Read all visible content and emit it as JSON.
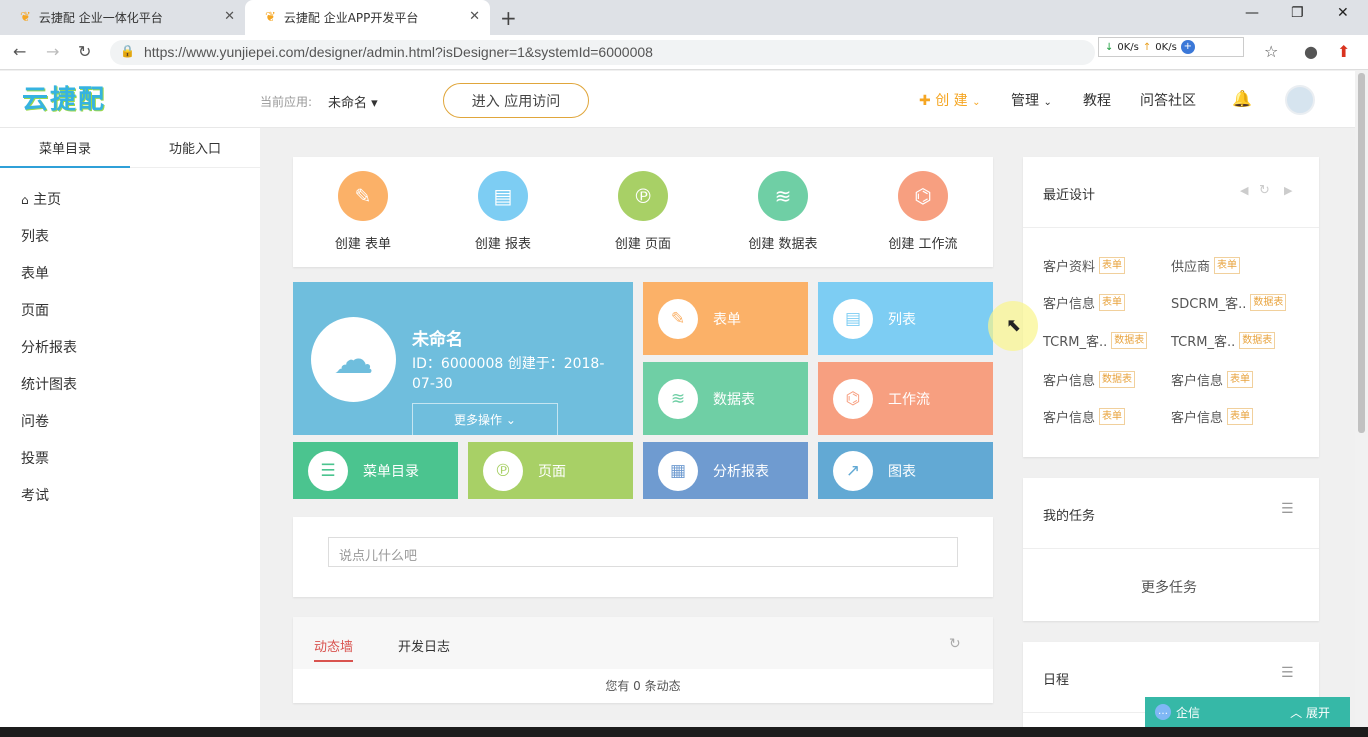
{
  "browser": {
    "tabs": [
      {
        "title": "云捷配 企业一体化平台"
      },
      {
        "title": "云捷配 企业APP开发平台"
      }
    ],
    "url": "https://www.yunjiepei.com/designer/admin.html?isDesigner=1&systemId=6000008",
    "net_down": "0K/s",
    "net_up": "0K/s"
  },
  "header": {
    "logo_text": "云捷配",
    "current_app_label": "当前应用:",
    "current_app_value": "未命名",
    "enter_button": "进入 应用访问",
    "nav": {
      "create": "创 建",
      "manage": "管理",
      "tutorial": "教程",
      "qa": "问答社区"
    }
  },
  "sidebar": {
    "tabs": [
      "菜单目录",
      "功能入口"
    ],
    "items": [
      "主页",
      "列表",
      "表单",
      "页面",
      "分析报表",
      "统计图表",
      "问卷",
      "投票",
      "考试"
    ]
  },
  "quick_create": [
    "创建 表单",
    "创建 报表",
    "创建 页面",
    "创建 数据表",
    "创建 工作流"
  ],
  "project": {
    "name": "未命名",
    "info": "ID：6000008 创建于：2018-07-30",
    "more_ops": "更多操作"
  },
  "tiles": {
    "form": "表单",
    "list": "列表",
    "datatable": "数据表",
    "workflow": "工作流",
    "menu": "菜单目录",
    "page": "页面",
    "report": "分析报表",
    "chart": "图表"
  },
  "post": {
    "placeholder": "说点儿什么吧"
  },
  "feed": {
    "tabs": [
      "动态墙",
      "开发日志"
    ],
    "empty_text": "您有 0 条动态"
  },
  "recent": {
    "title": "最近设计",
    "items": [
      {
        "name": "客户资料",
        "tag": "表单"
      },
      {
        "name": "供应商",
        "tag": "表单"
      },
      {
        "name": "客户信息",
        "tag": "表单"
      },
      {
        "name": "SDCRM_客..",
        "tag": "数据表"
      },
      {
        "name": "TCRM_客..",
        "tag": "数据表"
      },
      {
        "name": "TCRM_客..",
        "tag": "数据表"
      },
      {
        "name": "客户信息",
        "tag": "数据表"
      },
      {
        "name": "客户信息",
        "tag": "表单"
      },
      {
        "name": "客户信息",
        "tag": "表单"
      },
      {
        "name": "客户信息",
        "tag": "表单"
      }
    ]
  },
  "tasks": {
    "title": "我的任务",
    "more": "更多任务"
  },
  "schedule": {
    "title": "日程"
  },
  "chat": {
    "label": "企信",
    "expand": "展开"
  },
  "colors": {
    "orange": "#fbb168",
    "sky": "#7dcdf3",
    "green": "#6fcfa5",
    "salmon": "#f79f80",
    "teal": "#4bc48f",
    "lime": "#a8d066",
    "slate": "#6f9bd0",
    "steel": "#62a9d4",
    "project": "#6fbedd",
    "accent": "#f5a623"
  }
}
